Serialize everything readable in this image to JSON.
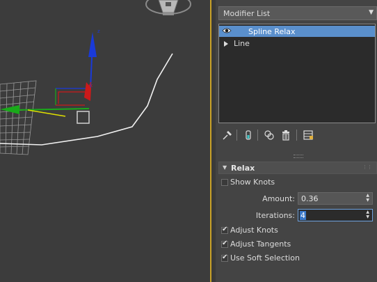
{
  "panel": {
    "modifier_list_label": "Modifier List",
    "stack": {
      "items": [
        {
          "label": "Spline Relax",
          "selected": true,
          "icon": "eye-icon"
        },
        {
          "label": "Line",
          "selected": false,
          "icon": "expand-triangle-icon"
        }
      ]
    },
    "toolbar": {
      "buttons": [
        "pin-stack-icon",
        "show-end-result-icon",
        "make-unique-icon",
        "remove-modifier-icon",
        "configure-modifier-sets-icon"
      ]
    },
    "relax_rollout": {
      "title": "Relax",
      "show_knots": {
        "label": "Show Knots",
        "checked": false
      },
      "amount": {
        "label": "Amount:",
        "value": "0.36"
      },
      "iterations": {
        "label": "Iterations:",
        "value": "4"
      },
      "adjust_knots": {
        "label": "Adjust Knots",
        "checked": true
      },
      "adjust_tangents": {
        "label": "Adjust Tangents",
        "checked": true
      },
      "use_soft_selection": {
        "label": "Use Soft Selection",
        "checked": true
      }
    }
  },
  "colors": {
    "viewport_bg": "#3c3c3c",
    "viewport_border": "#c9a227",
    "selection_blue": "#5a8fcc",
    "gizmo_x": "#cc1a1a",
    "gizmo_y": "#1aaa1a",
    "gizmo_z": "#1a3ad8"
  }
}
